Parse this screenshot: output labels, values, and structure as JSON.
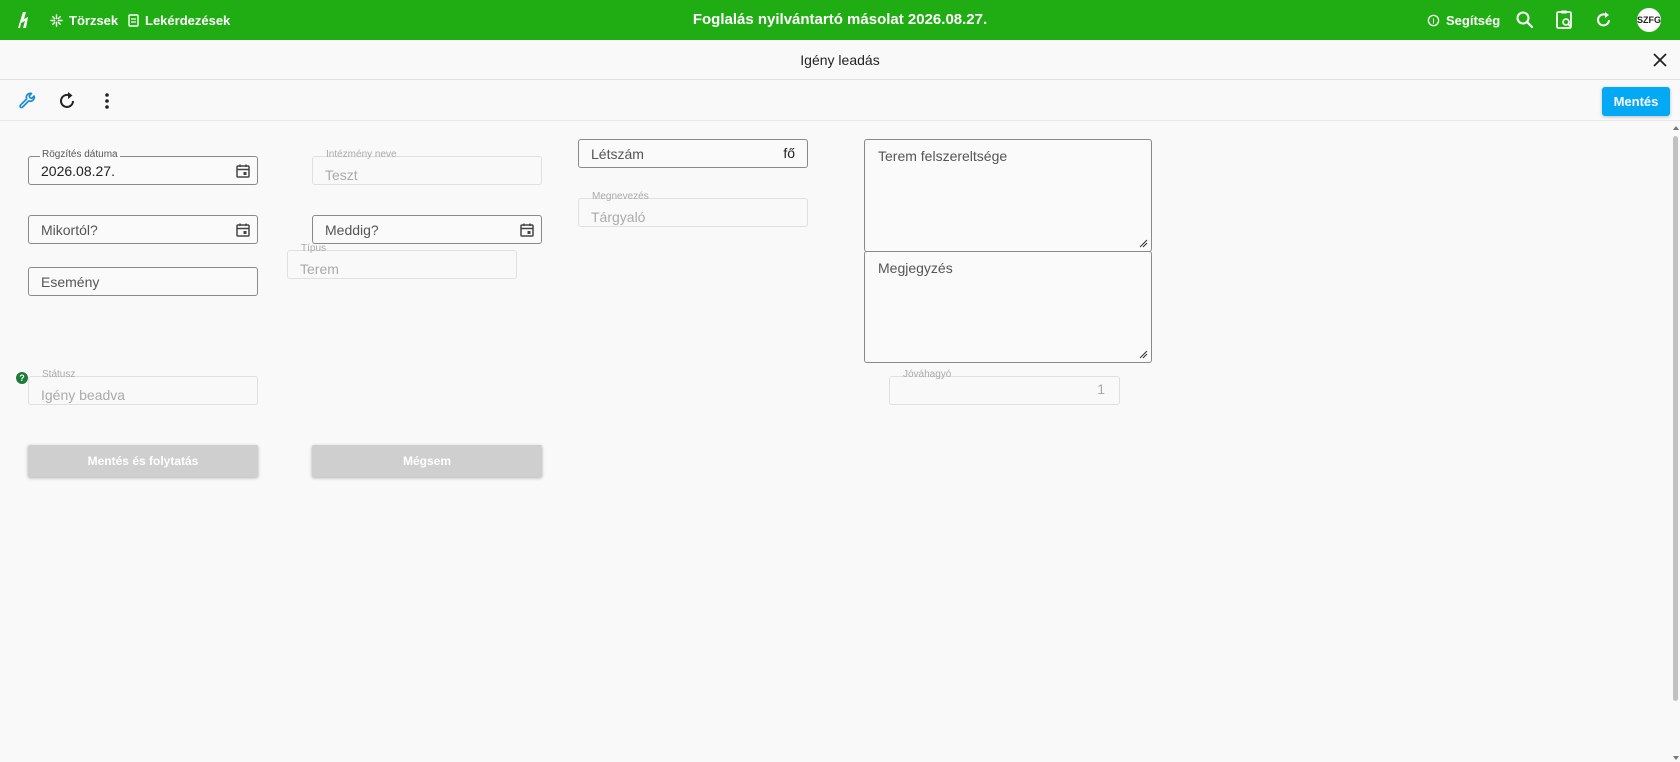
{
  "app": {
    "title": "Foglalás nyilvántartó másolat 2026.08.27.",
    "nav": [
      {
        "label": "Törzsek",
        "icon": "asterisk-icon"
      },
      {
        "label": "Lekérdezések",
        "icon": "document-icon"
      }
    ],
    "help_label": "Segítség",
    "user_initials": "SZFG",
    "accent_color": "#20ad14"
  },
  "page": {
    "title": "Igény leadás"
  },
  "toolbar": {
    "save_label": "Mentés",
    "save_color": "#03a9f4"
  },
  "form": {
    "rogzites_datuma": {
      "label": "Rögzítés dátuma",
      "value": "2026.08.27."
    },
    "intezmeny_neve": {
      "label": "Intézmény neve",
      "value": "Teszt"
    },
    "letszam": {
      "placeholder": "Létszám",
      "suffix": "fő"
    },
    "terem_felszereltsege": {
      "placeholder": "Terem felszereltsége"
    },
    "megnevezes": {
      "label": "Megnevezés",
      "value": "Tárgyaló"
    },
    "mikortol": {
      "placeholder": "Mikortól?"
    },
    "meddig": {
      "placeholder": "Meddig?"
    },
    "tipus": {
      "label": "Típus",
      "value": "Terem"
    },
    "esemeny": {
      "placeholder": "Esemény"
    },
    "megjegyzes": {
      "placeholder": "Megjegyzés"
    },
    "statusz": {
      "label": "Státusz",
      "value": "Igény beadva"
    },
    "jovahagyo": {
      "label": "Jóváhagyó",
      "value": "1"
    },
    "help_glyph": "?"
  },
  "buttons": {
    "save_continue": "Mentés és folytatás",
    "cancel": "Mégsem"
  }
}
